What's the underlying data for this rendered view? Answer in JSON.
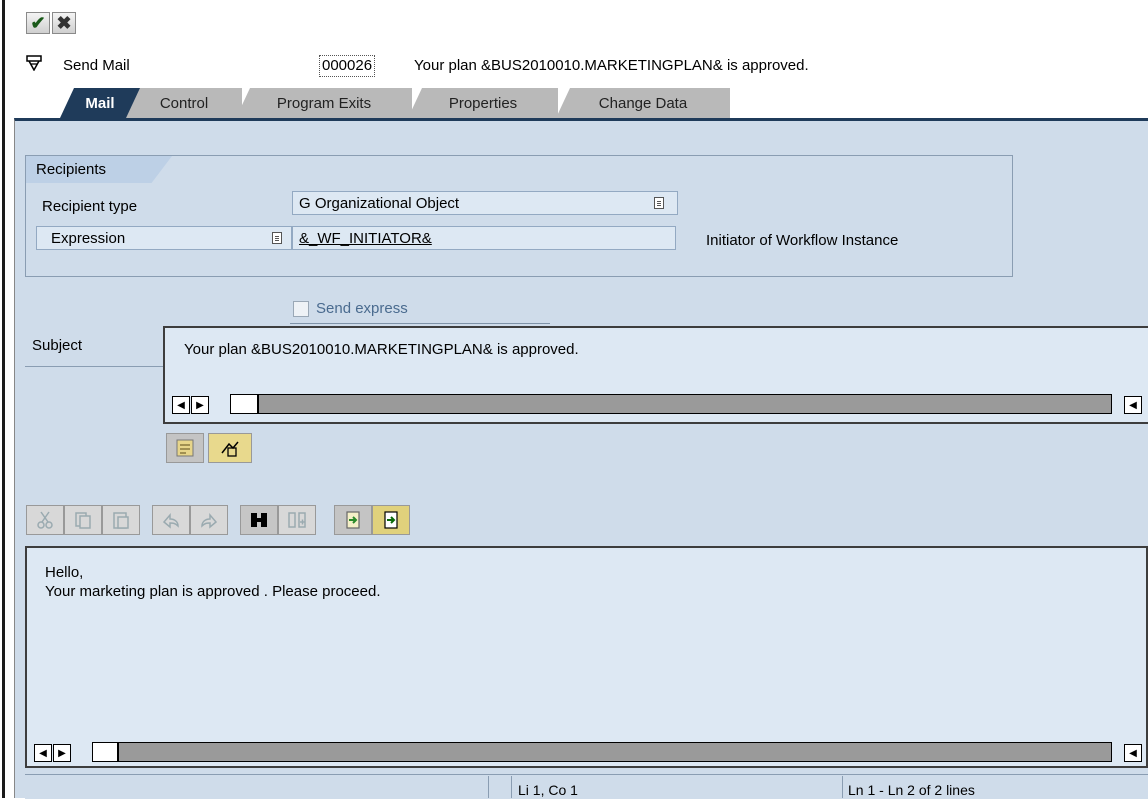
{
  "toolbar": {
    "ok_icon": "checkmark-icon",
    "cancel_icon": "cancel-icon",
    "ok_glyph": "✔",
    "cancel_glyph": "✖"
  },
  "header": {
    "step_label": "Send Mail",
    "step_id": "000026",
    "step_description": "Your plan &BUS2010010.MARKETINGPLAN& is approved."
  },
  "tabs": [
    {
      "label": "Mail",
      "active": true
    },
    {
      "label": "Control",
      "active": false
    },
    {
      "label": "Program Exits",
      "active": false
    },
    {
      "label": "Properties",
      "active": false
    },
    {
      "label": "Change Data",
      "active": false
    }
  ],
  "recipients": {
    "group_title": "Recipients",
    "recipient_type_label": "Recipient type",
    "recipient_type_value": "G Organizational Object",
    "expression_label": "Expression",
    "expression_value": "&_WF_INITIATOR&",
    "expression_description": "Initiator of Workflow Instance"
  },
  "send_express": {
    "label": "Send express",
    "checked": false
  },
  "subject": {
    "label": "Subject",
    "value": "Your plan &BUS2010010.MARKETINGPLAN& is approved."
  },
  "subject_tools": [
    "insert-expression-icon",
    "change-language-icon"
  ],
  "editor_toolbar": [
    {
      "icon": "cut-icon",
      "enabled": false
    },
    {
      "icon": "copy-icon",
      "enabled": false
    },
    {
      "icon": "paste-icon",
      "enabled": false
    },
    {
      "icon": "undo-icon",
      "enabled": false
    },
    {
      "icon": "redo-icon",
      "enabled": false
    },
    {
      "icon": "find-icon",
      "enabled": true
    },
    {
      "icon": "find-next-icon",
      "enabled": false
    },
    {
      "icon": "import-icon",
      "enabled": true
    },
    {
      "icon": "export-icon",
      "enabled": true
    }
  ],
  "body": {
    "line1": "Hello,",
    "line2": "Your marketing plan is approved . Please proceed."
  },
  "status": {
    "position": "Li 1, Co 1",
    "lines": "Ln 1 - Ln 2 of 2 lines"
  },
  "colors": {
    "panel_bg": "#cfdcea",
    "active_tab": "#1f3b5a",
    "field_bg": "#dde8f3"
  }
}
